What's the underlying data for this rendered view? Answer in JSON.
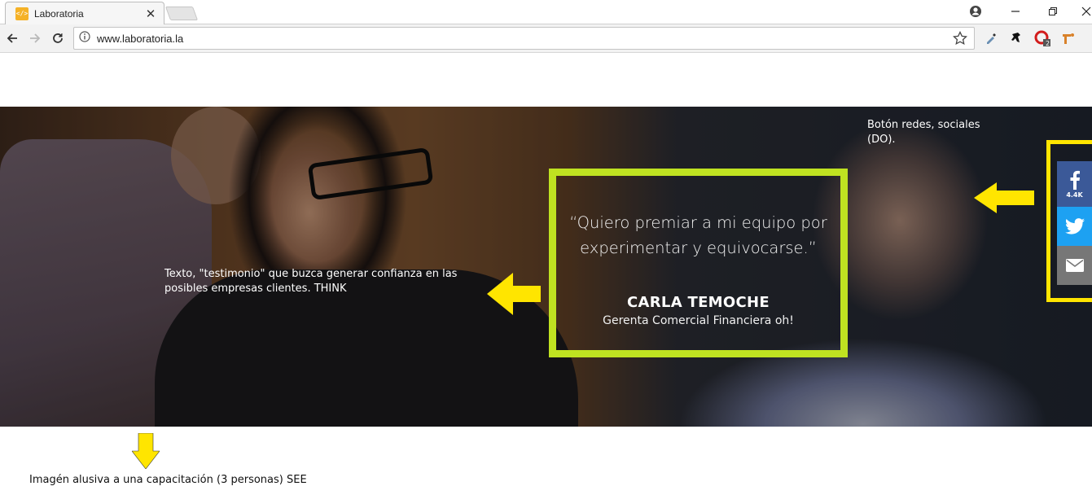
{
  "browser": {
    "tab_title": "Laboratoria",
    "tab_favicon": "</>",
    "url": "www.laboratoria.la",
    "extension_badge": "2"
  },
  "testimonial": {
    "quote": "“Quiero premiar a mi equipo por experimentar y equivocarse.”",
    "name": "CARLA TEMOCHE",
    "role": "Gerenta Comercial Financiera oh!",
    "frame_color": "#bfe221"
  },
  "social": {
    "facebook_count": "4.4K",
    "facebook_color": "#3b5998",
    "twitter_color": "#1da1f2",
    "email_color": "#777777",
    "frame_color": "#ffe500"
  },
  "annotations": {
    "social_note": "Botón redes, sociales (DO).",
    "testimonial_note": "Texto, \"testimonio\" que buzca generar confianza en las posibles empresas clientes. THINK",
    "image_note": "Imagén alusiva a una capacitación (3 personas) SEE",
    "arrow_color": "#ffe500"
  }
}
